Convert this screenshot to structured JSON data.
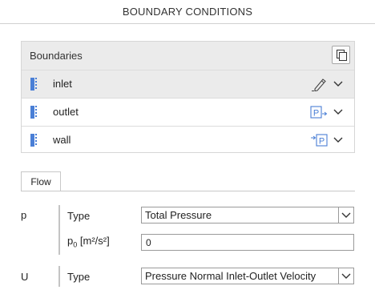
{
  "header": {
    "title": "BOUNDARY CONDITIONS"
  },
  "boundaries": {
    "title": "Boundaries",
    "items": [
      {
        "label": "inlet",
        "action_icon": "edit-pencil-icon",
        "selected": true
      },
      {
        "label": "outlet",
        "action_icon": "pressure-outlet-icon",
        "selected": false
      },
      {
        "label": "wall",
        "action_icon": "pressure-inlet-icon",
        "selected": false
      }
    ]
  },
  "tabs": [
    {
      "label": "Flow",
      "active": true
    }
  ],
  "flow": {
    "p": {
      "symbol": "p",
      "type_label": "Type",
      "type_value": "Total Pressure",
      "p0_label_base": "p",
      "p0_label_sub": "0",
      "p0_label_units": "[m²/s²]",
      "p0_value": "0"
    },
    "U": {
      "symbol": "U",
      "type_label": "Type",
      "type_value": "Pressure Normal Inlet-Outlet Velocity"
    }
  },
  "colors": {
    "accent": "#4a7fd6",
    "selected_row": "#ebebeb",
    "header_bg": "#ebebeb"
  }
}
